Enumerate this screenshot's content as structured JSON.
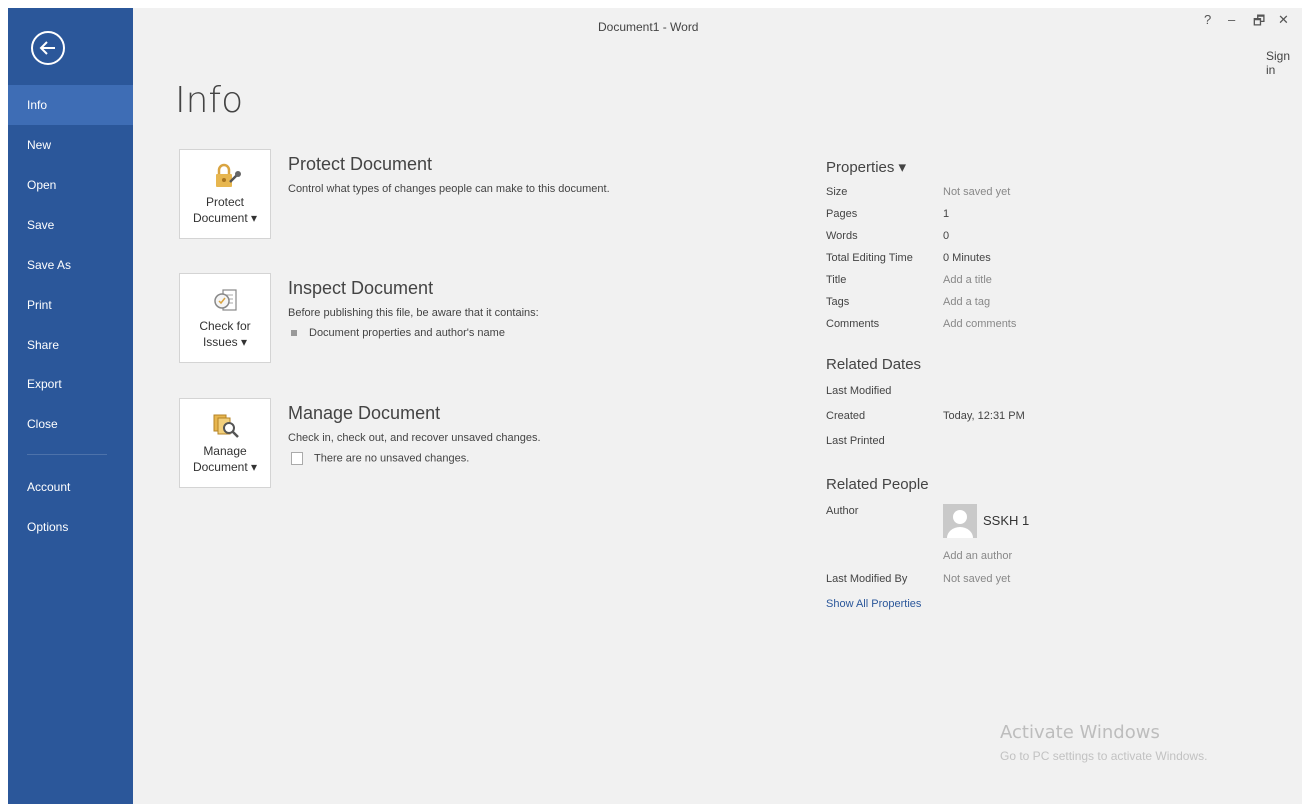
{
  "window": {
    "title": "Document1 - Word"
  },
  "titlebar": {
    "help": "?",
    "minimize": "–",
    "restore": "🗗",
    "close": "✕",
    "sign_in": "Sign in"
  },
  "sidebar": {
    "items": [
      {
        "label": "Info",
        "active": true
      },
      {
        "label": "New"
      },
      {
        "label": "Open"
      },
      {
        "label": "Save"
      },
      {
        "label": "Save As"
      },
      {
        "label": "Print"
      },
      {
        "label": "Share"
      },
      {
        "label": "Export"
      },
      {
        "label": "Close"
      },
      {
        "label": "Account"
      },
      {
        "label": "Options"
      }
    ]
  },
  "page": {
    "title": "Info"
  },
  "sections": {
    "protect": {
      "btn_line1": "Protect",
      "btn_line2": "Document ▾",
      "title": "Protect Document",
      "desc": "Control what types of changes people can make to this document."
    },
    "inspect": {
      "btn_line1": "Check for",
      "btn_line2": "Issues ▾",
      "title": "Inspect Document",
      "desc": "Before publishing this file, be aware that it contains:",
      "bullet": "Document properties and author's name"
    },
    "manage": {
      "btn_line1": "Manage",
      "btn_line2": "Document ▾",
      "title": "Manage Document",
      "desc": "Check in, check out, and recover unsaved changes.",
      "note": "There are no unsaved changes."
    }
  },
  "properties": {
    "heading": "Properties ▾",
    "rows": [
      {
        "k": "Size",
        "v": "Not saved yet"
      },
      {
        "k": "Pages",
        "v": "1"
      },
      {
        "k": "Words",
        "v": "0"
      },
      {
        "k": "Total Editing Time",
        "v": "0 Minutes"
      },
      {
        "k": "Title",
        "v": "Add a title"
      },
      {
        "k": "Tags",
        "v": "Add a tag"
      },
      {
        "k": "Comments",
        "v": "Add comments"
      }
    ]
  },
  "related_dates": {
    "heading": "Related Dates",
    "rows": [
      {
        "k": "Last Modified",
        "v": ""
      },
      {
        "k": "Created",
        "v": "Today, 12:31 PM"
      },
      {
        "k": "Last Printed",
        "v": ""
      }
    ]
  },
  "related_people": {
    "heading": "Related People",
    "author_label": "Author",
    "author_name": "SSKH 1",
    "add_author": "Add an author",
    "last_modified_by_label": "Last Modified By",
    "last_modified_by_value": "Not saved yet",
    "show_all": "Show All Properties"
  },
  "watermark": {
    "line1": "Activate Windows",
    "line2": "Go to PC settings to activate Windows."
  },
  "colors": {
    "sidebar": "#2b579a",
    "sidebar_active": "#3e6db5",
    "background": "#f1f1f1",
    "link": "#2b579a"
  },
  "icons": {
    "back": "back-arrow-icon",
    "protect": "lock-key-icon",
    "inspect": "inspect-document-icon",
    "manage": "manage-document-icon",
    "avatar": "user-avatar-icon"
  }
}
